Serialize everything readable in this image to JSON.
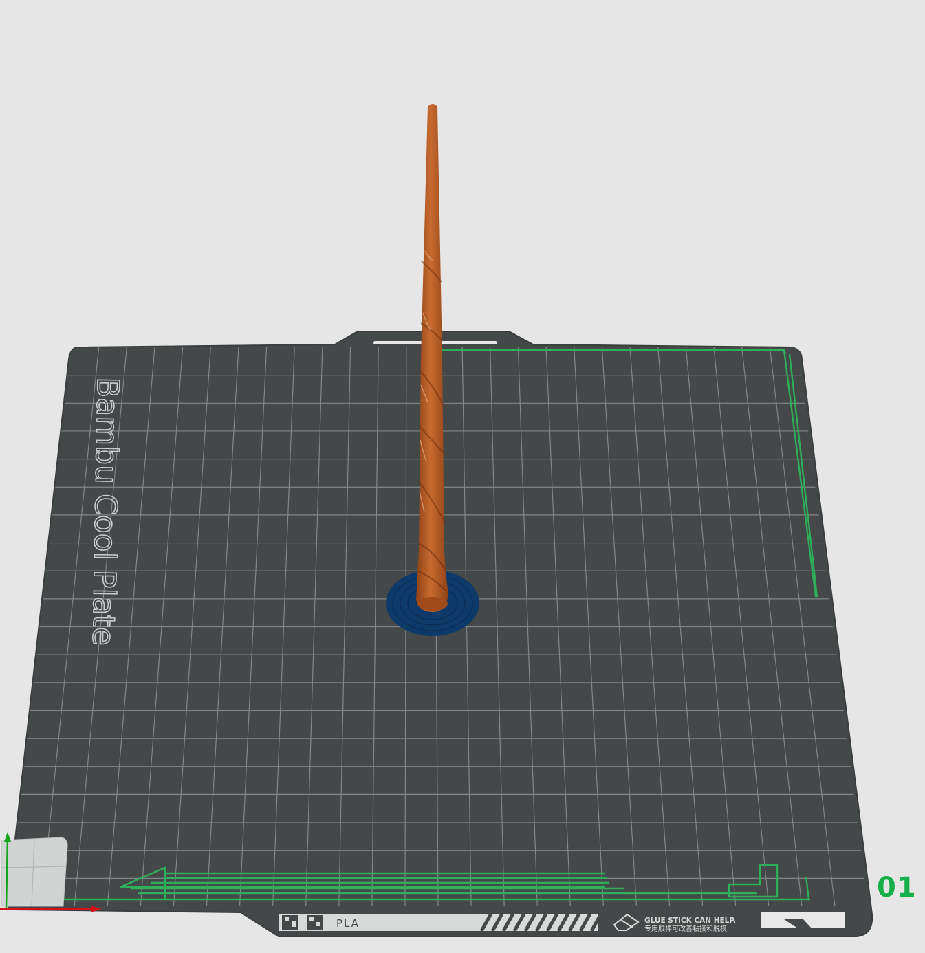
{
  "viewport": {
    "background_color": "#e6e6e6",
    "plate_color": "#454849",
    "grid_color": "#8a8d8e",
    "model_color": "#b85a23",
    "brim_color": "#0e3a6a",
    "purge_line_color": "#2eb05a"
  },
  "plate": {
    "brand_label": "Bambu Cool Plate",
    "filament_label": "PLA",
    "tip_line1": "GLUE STICK CAN HELP.",
    "tip_line2": "专用胶棒可改善粘接和脱模",
    "plate_number": "01"
  },
  "axes": {
    "x_color": "#d0121a",
    "y_color": "#17a51c"
  },
  "icons": {
    "qr": "qr-code-icon",
    "eraser": "eraser-icon",
    "navigator": "view-navigator-icon"
  }
}
